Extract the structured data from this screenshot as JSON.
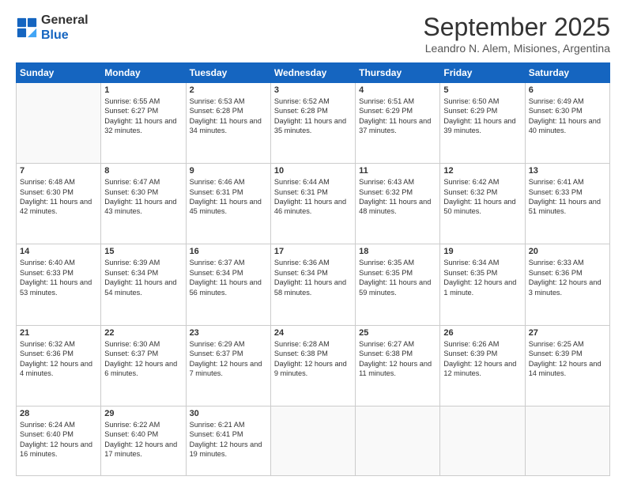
{
  "logo": {
    "line1": "General",
    "line2": "Blue"
  },
  "title": "September 2025",
  "subtitle": "Leandro N. Alem, Misiones, Argentina",
  "days": [
    "Sunday",
    "Monday",
    "Tuesday",
    "Wednesday",
    "Thursday",
    "Friday",
    "Saturday"
  ],
  "weeks": [
    [
      {
        "day": "",
        "sunrise": "",
        "sunset": "",
        "daylight": ""
      },
      {
        "day": "1",
        "sunrise": "Sunrise: 6:55 AM",
        "sunset": "Sunset: 6:27 PM",
        "daylight": "Daylight: 11 hours and 32 minutes."
      },
      {
        "day": "2",
        "sunrise": "Sunrise: 6:53 AM",
        "sunset": "Sunset: 6:28 PM",
        "daylight": "Daylight: 11 hours and 34 minutes."
      },
      {
        "day": "3",
        "sunrise": "Sunrise: 6:52 AM",
        "sunset": "Sunset: 6:28 PM",
        "daylight": "Daylight: 11 hours and 35 minutes."
      },
      {
        "day": "4",
        "sunrise": "Sunrise: 6:51 AM",
        "sunset": "Sunset: 6:29 PM",
        "daylight": "Daylight: 11 hours and 37 minutes."
      },
      {
        "day": "5",
        "sunrise": "Sunrise: 6:50 AM",
        "sunset": "Sunset: 6:29 PM",
        "daylight": "Daylight: 11 hours and 39 minutes."
      },
      {
        "day": "6",
        "sunrise": "Sunrise: 6:49 AM",
        "sunset": "Sunset: 6:30 PM",
        "daylight": "Daylight: 11 hours and 40 minutes."
      }
    ],
    [
      {
        "day": "7",
        "sunrise": "Sunrise: 6:48 AM",
        "sunset": "Sunset: 6:30 PM",
        "daylight": "Daylight: 11 hours and 42 minutes."
      },
      {
        "day": "8",
        "sunrise": "Sunrise: 6:47 AM",
        "sunset": "Sunset: 6:30 PM",
        "daylight": "Daylight: 11 hours and 43 minutes."
      },
      {
        "day": "9",
        "sunrise": "Sunrise: 6:46 AM",
        "sunset": "Sunset: 6:31 PM",
        "daylight": "Daylight: 11 hours and 45 minutes."
      },
      {
        "day": "10",
        "sunrise": "Sunrise: 6:44 AM",
        "sunset": "Sunset: 6:31 PM",
        "daylight": "Daylight: 11 hours and 46 minutes."
      },
      {
        "day": "11",
        "sunrise": "Sunrise: 6:43 AM",
        "sunset": "Sunset: 6:32 PM",
        "daylight": "Daylight: 11 hours and 48 minutes."
      },
      {
        "day": "12",
        "sunrise": "Sunrise: 6:42 AM",
        "sunset": "Sunset: 6:32 PM",
        "daylight": "Daylight: 11 hours and 50 minutes."
      },
      {
        "day": "13",
        "sunrise": "Sunrise: 6:41 AM",
        "sunset": "Sunset: 6:33 PM",
        "daylight": "Daylight: 11 hours and 51 minutes."
      }
    ],
    [
      {
        "day": "14",
        "sunrise": "Sunrise: 6:40 AM",
        "sunset": "Sunset: 6:33 PM",
        "daylight": "Daylight: 11 hours and 53 minutes."
      },
      {
        "day": "15",
        "sunrise": "Sunrise: 6:39 AM",
        "sunset": "Sunset: 6:34 PM",
        "daylight": "Daylight: 11 hours and 54 minutes."
      },
      {
        "day": "16",
        "sunrise": "Sunrise: 6:37 AM",
        "sunset": "Sunset: 6:34 PM",
        "daylight": "Daylight: 11 hours and 56 minutes."
      },
      {
        "day": "17",
        "sunrise": "Sunrise: 6:36 AM",
        "sunset": "Sunset: 6:34 PM",
        "daylight": "Daylight: 11 hours and 58 minutes."
      },
      {
        "day": "18",
        "sunrise": "Sunrise: 6:35 AM",
        "sunset": "Sunset: 6:35 PM",
        "daylight": "Daylight: 11 hours and 59 minutes."
      },
      {
        "day": "19",
        "sunrise": "Sunrise: 6:34 AM",
        "sunset": "Sunset: 6:35 PM",
        "daylight": "Daylight: 12 hours and 1 minute."
      },
      {
        "day": "20",
        "sunrise": "Sunrise: 6:33 AM",
        "sunset": "Sunset: 6:36 PM",
        "daylight": "Daylight: 12 hours and 3 minutes."
      }
    ],
    [
      {
        "day": "21",
        "sunrise": "Sunrise: 6:32 AM",
        "sunset": "Sunset: 6:36 PM",
        "daylight": "Daylight: 12 hours and 4 minutes."
      },
      {
        "day": "22",
        "sunrise": "Sunrise: 6:30 AM",
        "sunset": "Sunset: 6:37 PM",
        "daylight": "Daylight: 12 hours and 6 minutes."
      },
      {
        "day": "23",
        "sunrise": "Sunrise: 6:29 AM",
        "sunset": "Sunset: 6:37 PM",
        "daylight": "Daylight: 12 hours and 7 minutes."
      },
      {
        "day": "24",
        "sunrise": "Sunrise: 6:28 AM",
        "sunset": "Sunset: 6:38 PM",
        "daylight": "Daylight: 12 hours and 9 minutes."
      },
      {
        "day": "25",
        "sunrise": "Sunrise: 6:27 AM",
        "sunset": "Sunset: 6:38 PM",
        "daylight": "Daylight: 12 hours and 11 minutes."
      },
      {
        "day": "26",
        "sunrise": "Sunrise: 6:26 AM",
        "sunset": "Sunset: 6:39 PM",
        "daylight": "Daylight: 12 hours and 12 minutes."
      },
      {
        "day": "27",
        "sunrise": "Sunrise: 6:25 AM",
        "sunset": "Sunset: 6:39 PM",
        "daylight": "Daylight: 12 hours and 14 minutes."
      }
    ],
    [
      {
        "day": "28",
        "sunrise": "Sunrise: 6:24 AM",
        "sunset": "Sunset: 6:40 PM",
        "daylight": "Daylight: 12 hours and 16 minutes."
      },
      {
        "day": "29",
        "sunrise": "Sunrise: 6:22 AM",
        "sunset": "Sunset: 6:40 PM",
        "daylight": "Daylight: 12 hours and 17 minutes."
      },
      {
        "day": "30",
        "sunrise": "Sunrise: 6:21 AM",
        "sunset": "Sunset: 6:41 PM",
        "daylight": "Daylight: 12 hours and 19 minutes."
      },
      {
        "day": "",
        "sunrise": "",
        "sunset": "",
        "daylight": ""
      },
      {
        "day": "",
        "sunrise": "",
        "sunset": "",
        "daylight": ""
      },
      {
        "day": "",
        "sunrise": "",
        "sunset": "",
        "daylight": ""
      },
      {
        "day": "",
        "sunrise": "",
        "sunset": "",
        "daylight": ""
      }
    ]
  ]
}
